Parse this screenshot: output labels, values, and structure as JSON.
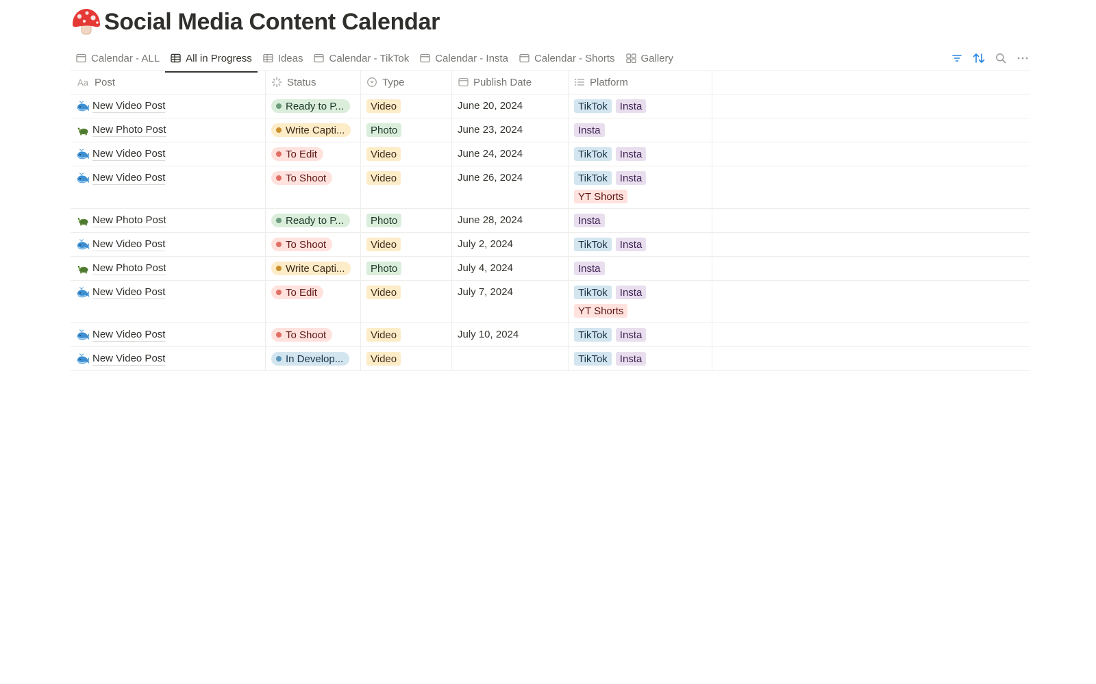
{
  "page": {
    "icon": "mushroom-emoji",
    "title": "Social Media Content Calendar"
  },
  "tabs": [
    {
      "label": "Calendar - ALL",
      "icon": "calendar-icon",
      "active": false
    },
    {
      "label": "All in Progress",
      "icon": "table-icon",
      "active": true
    },
    {
      "label": "Ideas",
      "icon": "table-icon",
      "active": false
    },
    {
      "label": "Calendar - TikTok",
      "icon": "calendar-icon",
      "active": false
    },
    {
      "label": "Calendar - Insta",
      "icon": "calendar-icon",
      "active": false
    },
    {
      "label": "Calendar - Shorts",
      "icon": "calendar-icon",
      "active": false
    },
    {
      "label": "Gallery",
      "icon": "gallery-icon",
      "active": false
    }
  ],
  "toolbar": {
    "filter_icon": "filter-icon",
    "sort_icon": "sort-icon",
    "search_icon": "search-icon",
    "more_icon": "more-icon",
    "accent": "#2383e2"
  },
  "columns": [
    {
      "label": "Post",
      "icon": "text-property-icon"
    },
    {
      "label": "Status",
      "icon": "status-property-icon"
    },
    {
      "label": "Type",
      "icon": "select-property-icon"
    },
    {
      "label": "Publish Date",
      "icon": "date-property-icon"
    },
    {
      "label": "Platform",
      "icon": "multiselect-property-icon"
    }
  ],
  "status_colors": {
    "Ready to P...": {
      "bg": "#dbeddb",
      "dot": "#6c9b7d",
      "text": "#1c3829"
    },
    "Write Capti...": {
      "bg": "#fdecc8",
      "dot": "#cb912f",
      "text": "#402c1b"
    },
    "To Edit": {
      "bg": "#ffe2dd",
      "dot": "#e16f64",
      "text": "#5d1715"
    },
    "To Shoot": {
      "bg": "#ffe2dd",
      "dot": "#e16f64",
      "text": "#5d1715"
    },
    "In Develop...": {
      "bg": "#d3e5ef",
      "dot": "#5b97bd",
      "text": "#183347"
    }
  },
  "type_colors": {
    "Video": {
      "bg": "#fdecc8",
      "text": "#402c1b"
    },
    "Photo": {
      "bg": "#dbeddb",
      "text": "#1c3829"
    }
  },
  "platform_colors": {
    "TikTok": {
      "bg": "#d3e5ef",
      "text": "#183347"
    },
    "Insta": {
      "bg": "#e8deee",
      "text": "#412454"
    },
    "YT Shorts": {
      "bg": "#ffe2dd",
      "text": "#5d1715"
    }
  },
  "rows": [
    {
      "emoji": "whale",
      "post": "New Video Post",
      "status": "Ready to P...",
      "type": "Video",
      "date": "June 20, 2024",
      "platforms": [
        "TikTok",
        "Insta"
      ]
    },
    {
      "emoji": "turtle",
      "post": "New Photo Post",
      "status": "Write Capti...",
      "type": "Photo",
      "date": "June 23, 2024",
      "platforms": [
        "Insta"
      ]
    },
    {
      "emoji": "whale",
      "post": "New Video Post",
      "status": "To Edit",
      "type": "Video",
      "date": "June 24, 2024",
      "platforms": [
        "TikTok",
        "Insta"
      ]
    },
    {
      "emoji": "whale",
      "post": "New Video Post",
      "status": "To Shoot",
      "type": "Video",
      "date": "June 26, 2024",
      "platforms": [
        "TikTok",
        "Insta",
        "YT Shorts"
      ]
    },
    {
      "emoji": "turtle",
      "post": "New Photo Post",
      "status": "Ready to P...",
      "type": "Photo",
      "date": "June 28, 2024",
      "platforms": [
        "Insta"
      ]
    },
    {
      "emoji": "whale",
      "post": "New Video Post",
      "status": "To Shoot",
      "type": "Video",
      "date": "July 2, 2024",
      "platforms": [
        "TikTok",
        "Insta"
      ]
    },
    {
      "emoji": "turtle",
      "post": "New Photo Post",
      "status": "Write Capti...",
      "type": "Photo",
      "date": "July 4, 2024",
      "platforms": [
        "Insta"
      ]
    },
    {
      "emoji": "whale",
      "post": "New Video Post",
      "status": "To Edit",
      "type": "Video",
      "date": "July 7, 2024",
      "platforms": [
        "TikTok",
        "Insta",
        "YT Shorts"
      ]
    },
    {
      "emoji": "whale",
      "post": "New Video Post",
      "status": "To Shoot",
      "type": "Video",
      "date": "July 10, 2024",
      "platforms": [
        "TikTok",
        "Insta"
      ]
    },
    {
      "emoji": "whale",
      "post": "New Video Post",
      "status": "In Develop...",
      "type": "Video",
      "date": "",
      "platforms": [
        "TikTok",
        "Insta"
      ]
    }
  ]
}
